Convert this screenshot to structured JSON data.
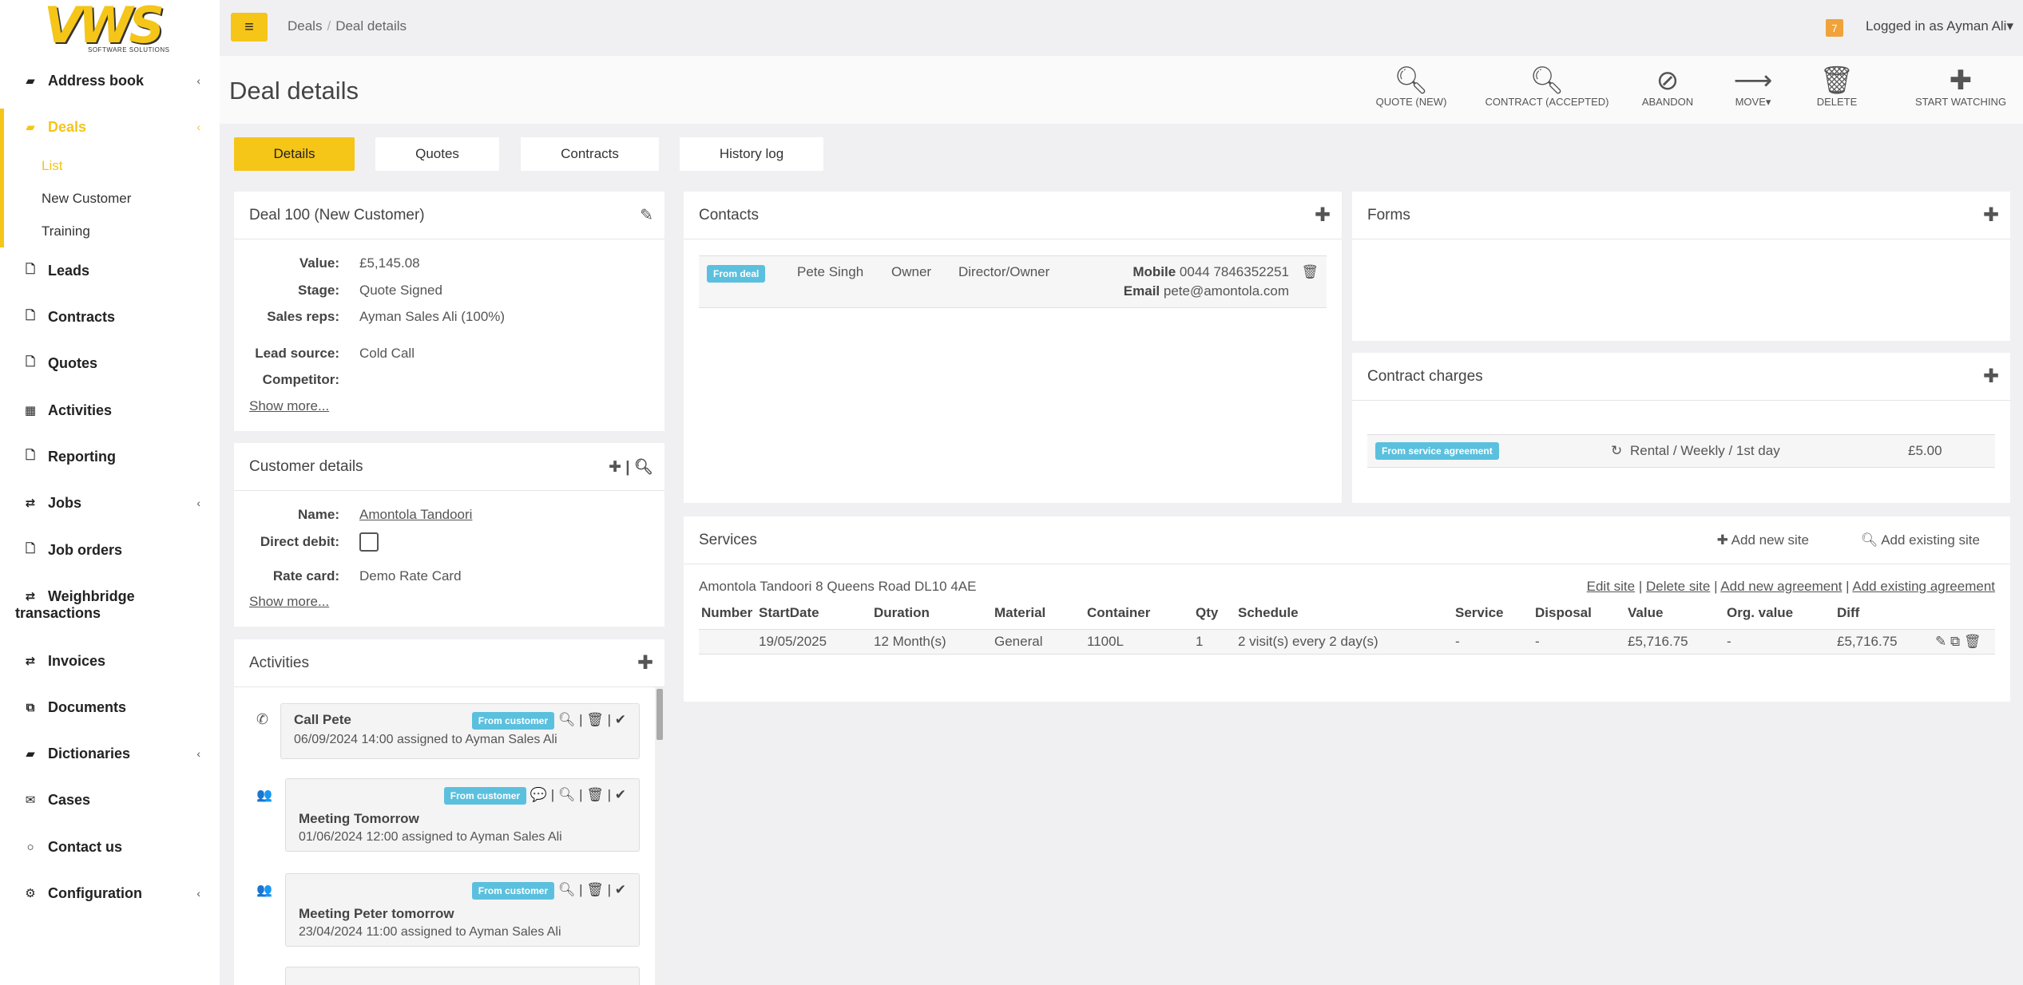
{
  "logo": {
    "text": "VWS",
    "sub": "SOFTWARE SOLUTIONS"
  },
  "sidebar": {
    "items": [
      {
        "label": "Address book",
        "icon": "book-icon",
        "glyph": "▰",
        "chev": "‹"
      },
      {
        "label": "Deals",
        "icon": "book-icon",
        "glyph": "▰",
        "chev": "‹"
      },
      {
        "label": "Leads",
        "icon": "file-icon",
        "glyph": "🗋",
        "chev": ""
      },
      {
        "label": "Contracts",
        "icon": "file-icon",
        "glyph": "🗋",
        "chev": ""
      },
      {
        "label": "Quotes",
        "icon": "file-icon",
        "glyph": "🗋",
        "chev": ""
      },
      {
        "label": "Activities",
        "icon": "calendar-icon",
        "glyph": "▦",
        "chev": ""
      },
      {
        "label": "Reporting",
        "icon": "file-icon",
        "glyph": "🗋",
        "chev": ""
      },
      {
        "label": "Jobs",
        "icon": "exchange-icon",
        "glyph": "⇄",
        "chev": "‹"
      },
      {
        "label": "Job orders",
        "icon": "file-icon",
        "glyph": "🗋",
        "chev": ""
      },
      {
        "label": "Weighbridge",
        "label2": "transactions",
        "icon": "exchange-icon",
        "glyph": "⇄",
        "chev": ""
      },
      {
        "label": "Invoices",
        "icon": "exchange-icon",
        "glyph": "⇄",
        "chev": ""
      },
      {
        "label": "Documents",
        "icon": "copy-icon",
        "glyph": "⧉",
        "chev": ""
      },
      {
        "label": "Dictionaries",
        "icon": "book-icon",
        "glyph": "▰",
        "chev": "‹"
      },
      {
        "label": "Cases",
        "icon": "envelope-icon",
        "glyph": "✉",
        "chev": ""
      },
      {
        "label": "Contact us",
        "icon": "comment-icon",
        "glyph": "○",
        "chev": ""
      },
      {
        "label": "Configuration",
        "icon": "cogs-icon",
        "glyph": "⚙",
        "chev": "‹"
      }
    ],
    "deals_sub": [
      "List",
      "New Customer",
      "Training"
    ]
  },
  "topbar": {
    "menu_glyph": "≡",
    "crumb1": "Deals",
    "crumb_sep": "/",
    "crumb2": "Deal details",
    "notif_count": "7",
    "user": "Logged in as Ayman Ali▾"
  },
  "header": {
    "title": "Deal details",
    "actions": [
      {
        "label": "QUOTE (NEW)",
        "glyph": "🔍︎",
        "icon": "search-icon"
      },
      {
        "label": "CONTRACT (ACCEPTED)",
        "glyph": "🔍︎",
        "icon": "search-icon"
      },
      {
        "label": "ABANDON",
        "glyph": "⊘",
        "icon": "ban-icon"
      },
      {
        "label": "MOVE▾",
        "glyph": "⟶",
        "icon": "arrow-right-icon"
      },
      {
        "label": "DELETE",
        "glyph": "🗑",
        "icon": "trash-icon"
      },
      {
        "label": "START WATCHING",
        "glyph": "✚",
        "icon": "plus-icon"
      }
    ]
  },
  "tabs": [
    "Details",
    "Quotes",
    "Contracts",
    "History log"
  ],
  "deal": {
    "title": "Deal 100 (New Customer)",
    "edit_glyph": "✎",
    "value_k": "Value:",
    "value_v": "£5,145.08",
    "stage_k": "Stage:",
    "stage_v": "Quote Signed",
    "reps_k": "Sales reps:",
    "reps_v": "Ayman Sales Ali (100%)",
    "lead_k": "Lead source:",
    "lead_v": "Cold Call",
    "comp_k": "Competitor:",
    "show_more": "Show more..."
  },
  "customer": {
    "title": "Customer details",
    "tools": "✚ | 🔍︎",
    "name_k": "Name:",
    "name_v": "Amontola Tandoori",
    "dd_k": "Direct debit:",
    "rate_k": "Rate card:",
    "rate_v": "Demo Rate Card",
    "show_more": "Show more..."
  },
  "activities": {
    "title": "Activities",
    "plus": "✚",
    "items": [
      {
        "title": "Call Pete",
        "sub": "06/09/2024 14:00 assigned to Ayman Sales Ali",
        "badge": "From customer",
        "tools": "🔍︎ | 🗑 | ✔",
        "glyph": "✆"
      },
      {
        "title": "Meeting Tomorrow",
        "sub": "01/06/2024 12:00 assigned to Ayman Sales Ali",
        "badge": "From customer",
        "tools": "💬 | 🔍︎ | 🗑 | ✔",
        "glyph": "👥"
      },
      {
        "title": "Meeting Peter tomorrow",
        "sub": "23/04/2024 11:00 assigned to Ayman Sales Ali",
        "badge": "From customer",
        "tools": "🔍︎ | 🗑 | ✔",
        "glyph": "👥"
      }
    ]
  },
  "contacts": {
    "title": "Contacts",
    "plus": "✚",
    "row": {
      "badge": "From deal",
      "name": "Pete Singh",
      "role": "Owner",
      "position": "Director/Owner",
      "mobile_k": "Mobile",
      "mobile_v": "0044 7846352251",
      "email_k": "Email",
      "email_v": "pete@amontola.com"
    }
  },
  "forms": {
    "title": "Forms",
    "plus": "✚"
  },
  "charges": {
    "title": "Contract charges",
    "plus": "✚",
    "badge": "From service agreement",
    "desc": "Rental / Weekly / 1st day",
    "amount": "£5.00",
    "glyph": "↻"
  },
  "services": {
    "title": "Services",
    "add_new": "✚ Add new site",
    "add_existing": "🔍︎ Add existing site",
    "site": "Amontola Tandoori 8 Queens Road DL10 4AE",
    "site_links": [
      "Edit site",
      "Delete site",
      "Add new agreement",
      "Add existing agreement"
    ],
    "link_sep": "|",
    "headers": [
      "Number",
      "StartDate",
      "Duration",
      "Material",
      "Container",
      "Qty",
      "Schedule",
      "Service",
      "Disposal",
      "Value",
      "Org. value",
      "Diff"
    ],
    "row": [
      "",
      "19/05/2025",
      "12 Month(s)",
      "General",
      "1100L",
      "1",
      "2 visit(s) every 2 day(s)",
      "-",
      "-",
      "£5,716.75",
      "-",
      "£5,716.75"
    ],
    "row_tools": "✎ ⧉ 🗑"
  }
}
